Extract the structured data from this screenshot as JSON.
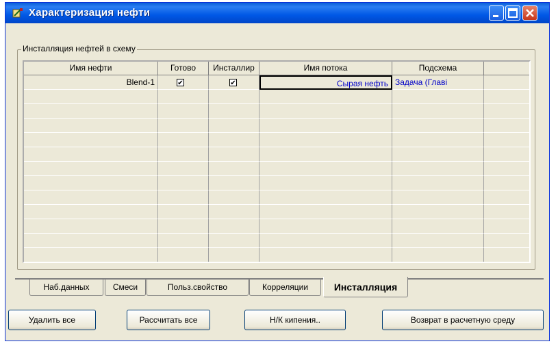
{
  "window": {
    "title": "Характеризация нефти"
  },
  "group": {
    "label": "Инсталляция нефтей в схему"
  },
  "grid": {
    "columns": [
      "Имя нефти",
      "Готово",
      "Инсталлир",
      "Имя потока",
      "Подсхема",
      ""
    ],
    "rows": [
      {
        "oil_name": "Blend-1",
        "ready": true,
        "installed": true,
        "stream": "Сырая нефть",
        "subflowsheet": "Задача (Главі"
      }
    ]
  },
  "tabs": [
    {
      "label": "Наб.данных"
    },
    {
      "label": "Смеси"
    },
    {
      "label": "Польз.свойство"
    },
    {
      "label": "Корреляции"
    },
    {
      "label": "Инсталляция",
      "active": true
    }
  ],
  "buttons": {
    "delete_all": "Удалить все",
    "calculate_all": "Рассчитать все",
    "boiling": "Н/К кипения..",
    "return": "Возврат в расчетную среду"
  },
  "colors": {
    "titlebar": "#0058e6",
    "stream_text": "#0000c8"
  }
}
